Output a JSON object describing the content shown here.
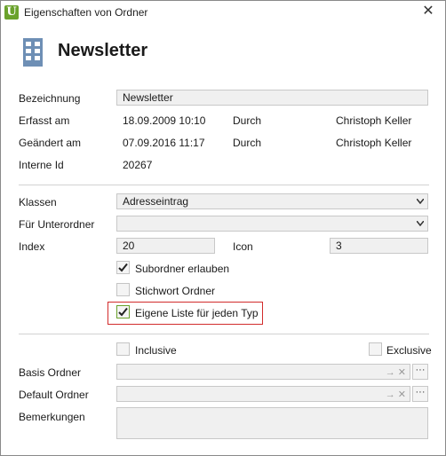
{
  "window": {
    "title": "Eigenschaften von Ordner",
    "app_icon_letter": "U",
    "close_symbol": "✕"
  },
  "header": {
    "title": "Newsletter",
    "icon": "building-icon"
  },
  "info": {
    "bezeichnung_label": "Bezeichnung",
    "bezeichnung_value": "Newsletter",
    "erfasst_label": "Erfasst am",
    "erfasst_value": "18.09.2009 10:10",
    "erfasst_durch_label": "Durch",
    "erfasst_durch_value": "Christoph Keller",
    "geaendert_label": "Geändert am",
    "geaendert_value": "07.09.2016 11:17",
    "geaendert_durch_label": "Durch",
    "geaendert_durch_value": "Christoph Keller",
    "interne_id_label": "Interne Id",
    "interne_id_value": "20267"
  },
  "settings": {
    "klassen_label": "Klassen",
    "klassen_value": "Adresseintrag",
    "unterordner_label": "Für Unterordner",
    "unterordner_value": "",
    "index_label": "Index",
    "index_value": "20",
    "icon_label": "Icon",
    "icon_value": "3"
  },
  "checkboxes": {
    "subordner": {
      "label": "Subordner erlauben",
      "checked": true
    },
    "stichwort": {
      "label": "Stichwort Ordner",
      "checked": false
    },
    "eigene_liste": {
      "label": "Eigene Liste für jeden Typ",
      "checked": true
    },
    "inclusive": {
      "label": "Inclusive",
      "checked": false
    },
    "exclusive": {
      "label": "Exclusive",
      "checked": false
    }
  },
  "folders": {
    "basis_label": "Basis Ordner",
    "basis_value": "",
    "default_label": "Default Ordner",
    "default_value": "",
    "browse_symbol": "···",
    "field_icons": "→ ✕",
    "bemerkungen_label": "Bemerkungen"
  },
  "colors": {
    "accent": "#6aa22c",
    "highlight_border": "#d22c2c",
    "icon_blue": "#6e8fb5"
  }
}
